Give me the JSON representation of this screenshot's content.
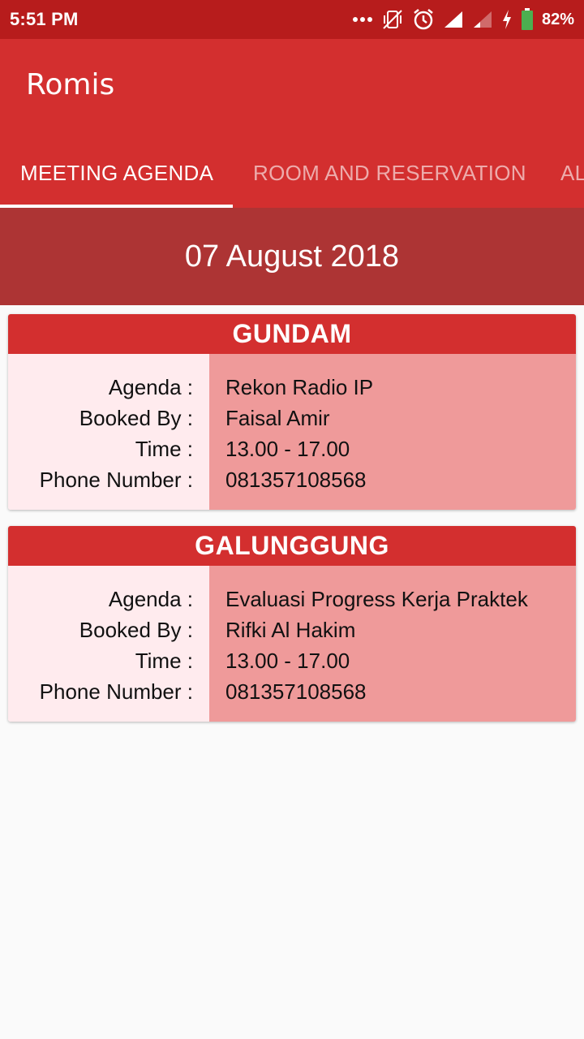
{
  "status_bar": {
    "time": "5:51 PM",
    "battery": "82%",
    "icons": [
      "more-dots-icon",
      "vibrate-off-icon",
      "alarm-icon",
      "signal-icon",
      "signal-weak-icon",
      "charging-icon",
      "battery-icon"
    ]
  },
  "app": {
    "title": "Romis"
  },
  "tabs": [
    {
      "label": "MEETING AGENDA",
      "active": true
    },
    {
      "label": "ROOM AND RESERVATION",
      "active": false
    },
    {
      "label": "AL",
      "active": false
    }
  ],
  "date": "07 August 2018",
  "field_labels": {
    "agenda": "Agenda :",
    "booked_by": "Booked By :",
    "time": "Time :",
    "phone": "Phone Number :"
  },
  "meetings": [
    {
      "room": "GUNDAM",
      "agenda": "Rekon Radio IP",
      "booked_by": "Faisal Amir",
      "time": "13.00 - 17.00",
      "phone": "081357108568"
    },
    {
      "room": "GALUNGGUNG",
      "agenda": "Evaluasi Progress Kerja Praktek",
      "booked_by": "Rifki Al Hakim",
      "time": "13.00 - 17.00",
      "phone": "081357108568"
    }
  ],
  "colors": {
    "status_bar": "#b71c1c",
    "primary": "#d32f2f",
    "date_banner": "#ad3434",
    "label_bg": "#ffebee",
    "value_bg": "#ef9a9a",
    "battery_green": "#4caf50"
  }
}
